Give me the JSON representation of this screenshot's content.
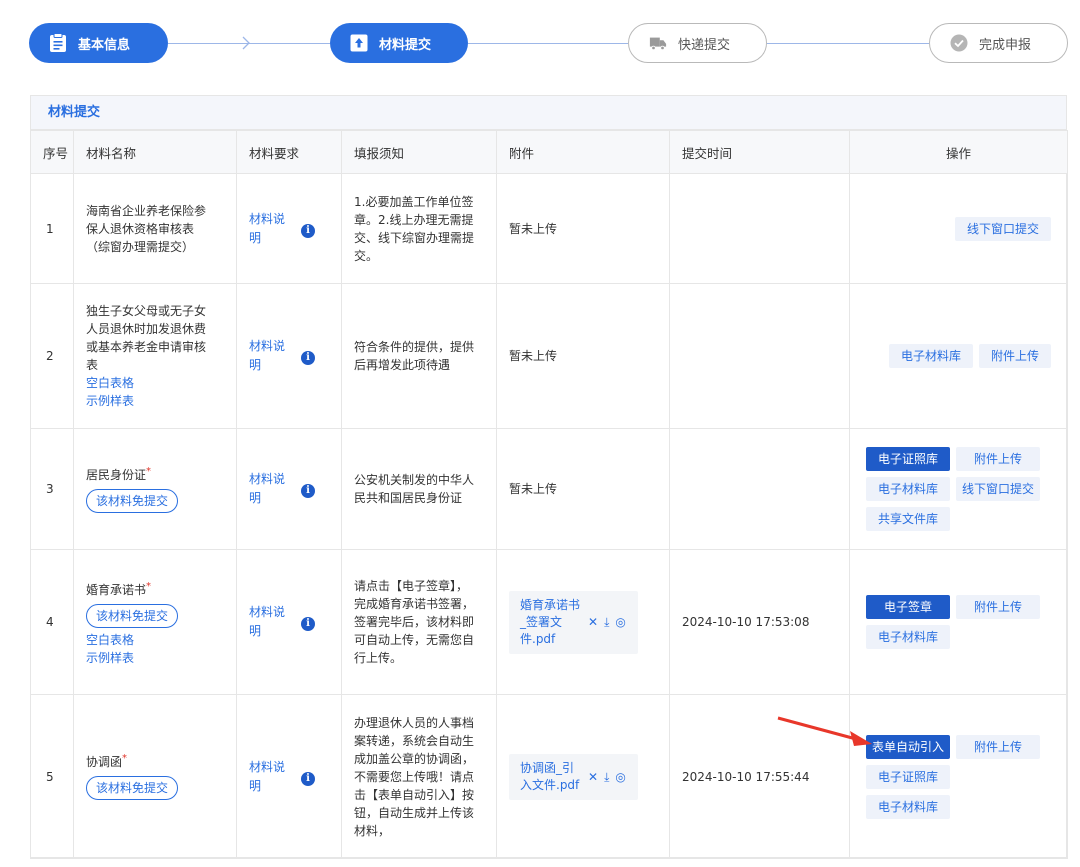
{
  "steps": [
    {
      "label": "基本信息",
      "state": "active",
      "icon": "clipboard-icon"
    },
    {
      "label": "材料提交",
      "state": "active",
      "icon": "upload-icon"
    },
    {
      "label": "快递提交",
      "state": "inactive",
      "icon": "truck-icon"
    },
    {
      "label": "完成申报",
      "state": "inactive",
      "icon": "check-circle-icon"
    }
  ],
  "section_title": "材料提交",
  "table": {
    "headers": [
      "序号",
      "材料名称",
      "材料要求",
      "填报须知",
      "附件",
      "提交时间",
      "操作"
    ],
    "rows": [
      {
        "index": "1",
        "name": "海南省企业养老保险参保人退休资格审核表（综窗办理需提交）",
        "required": false,
        "exempt_tag": "",
        "links": [],
        "requirement": "材料说明",
        "notice": "1.必要加盖工作单位签章。2.线上办理无需提交、线下综窗办理需提交。",
        "attachment": "暂未上传",
        "time": "",
        "ops": [
          "线下窗口提交"
        ]
      },
      {
        "index": "2",
        "name": "独生子女父母或无子女人员退休时加发退休费或基本养老金申请审核表",
        "required": false,
        "exempt_tag": "",
        "links": [
          "空白表格",
          "示例样表"
        ],
        "requirement": "材料说明",
        "notice": "符合条件的提供，提供后再增发此项待遇",
        "attachment": "暂未上传",
        "time": "",
        "ops": [
          "电子材料库",
          "附件上传"
        ]
      },
      {
        "index": "3",
        "name": "居民身份证",
        "required": true,
        "exempt_tag": "该材料免提交",
        "links": [],
        "requirement": "材料说明",
        "notice": "公安机关制发的中华人民共和国居民身份证",
        "attachment": "暂未上传",
        "time": "",
        "ops": [
          "电子证照库",
          "附件上传",
          "电子材料库",
          "线下窗口提交",
          "共享文件库"
        ]
      },
      {
        "index": "4",
        "name": "婚育承诺书",
        "required": true,
        "exempt_tag": "该材料免提交",
        "links": [
          "空白表格",
          "示例样表"
        ],
        "requirement": "材料说明",
        "notice": "请点击【电子签章】，完成婚育承诺书签署，签署完毕后，该材料即可自动上传，无需您自行上传。",
        "attachment_file": "婚育承诺书_签署文件.pdf",
        "time": "2024-10-10 17:53:08",
        "ops": [
          "电子签章",
          "附件上传",
          "电子材料库"
        ]
      },
      {
        "index": "5",
        "name": "协调函",
        "required": true,
        "exempt_tag": "该材料免提交",
        "links": [],
        "requirement": "材料说明",
        "notice": "办理退休人员的人事档案转递，系统会自动生成加盖公章的协调函，不需要您上传哦！请点击【表单自动引入】按钮，自动生成并上传该材料，",
        "attachment_file": "协调函_引入文件.pdf",
        "time": "2024-10-10 17:55:44",
        "ops": [
          "表单自动引入",
          "附件上传",
          "电子证照库",
          "电子材料库"
        ]
      }
    ]
  },
  "required_mark": "*",
  "colors": {
    "accent": "#2a6fe0",
    "button_primary": "#1f5bc8",
    "arrow": "#e8372a"
  }
}
